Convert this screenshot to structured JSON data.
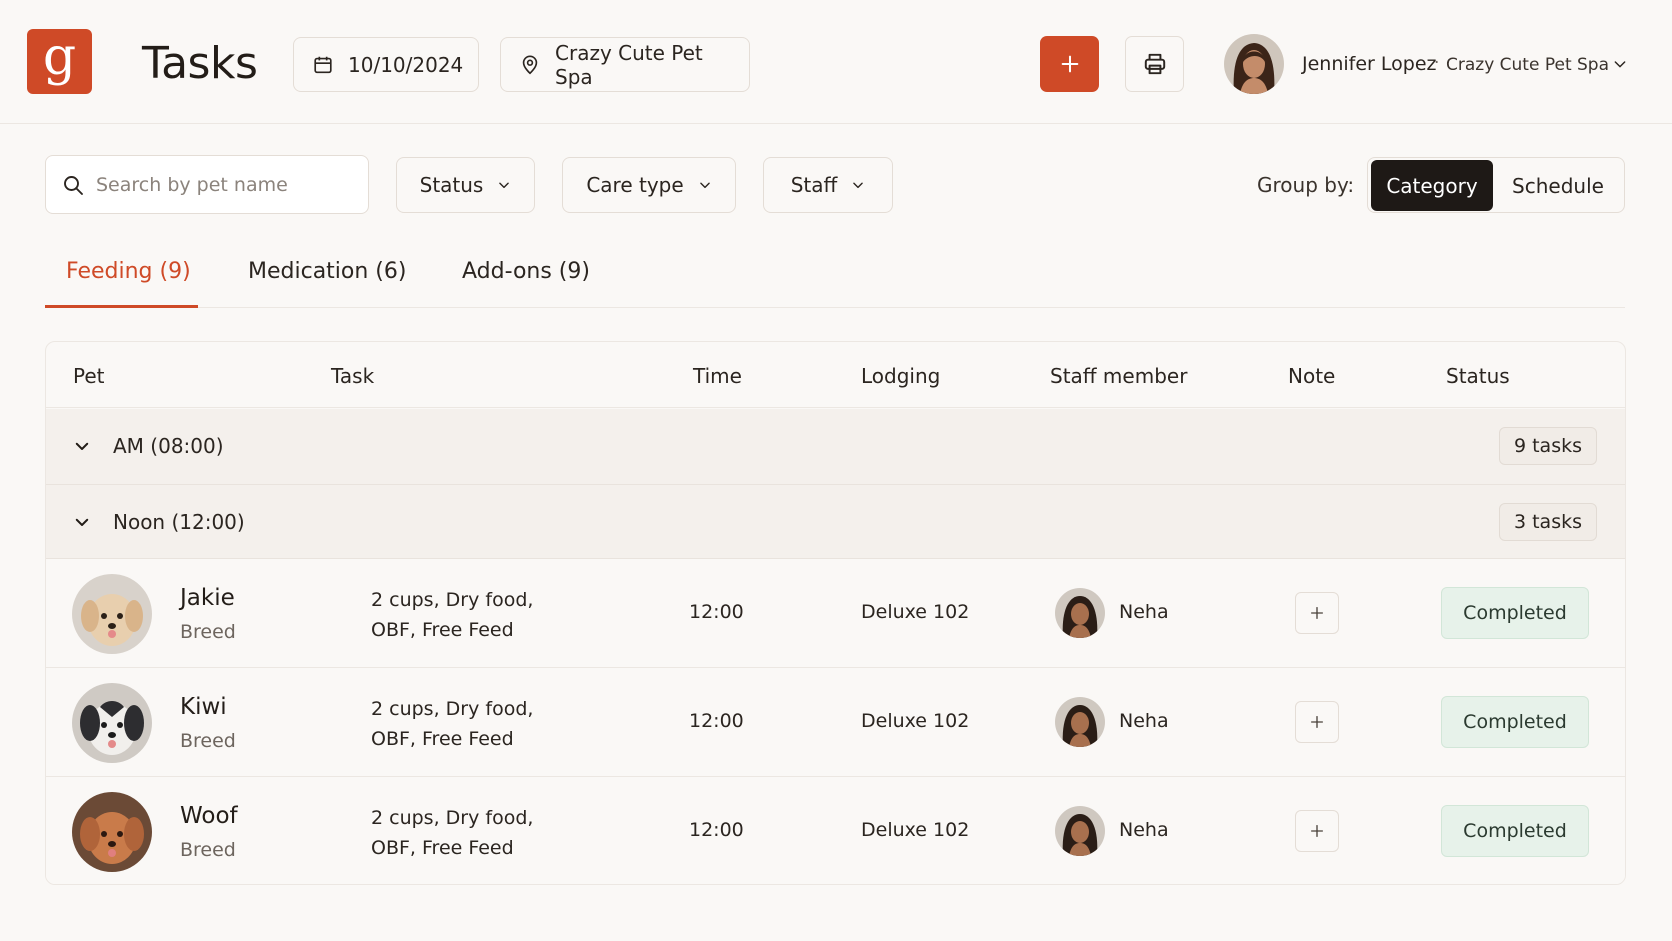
{
  "brand": {
    "logo_letter": "g",
    "accent": "#cf4a27"
  },
  "header": {
    "title": "Tasks",
    "date": "10/10/2024",
    "location": "Crazy Cute Pet Spa",
    "user": {
      "name": "Jennifer Lopez",
      "separator": "·",
      "org": "Crazy Cute Pet Spa"
    }
  },
  "filters": {
    "search_placeholder": "Search by pet name",
    "status": "Status",
    "care_type": "Care type",
    "staff": "Staff",
    "group_by_label": "Group by:",
    "group_options": [
      "Category",
      "Schedule"
    ],
    "group_selected": "Category"
  },
  "tabs": [
    {
      "label": "Feeding (9)",
      "active": true
    },
    {
      "label": "Medication (6)",
      "active": false
    },
    {
      "label": "Add-ons (9)",
      "active": false
    }
  ],
  "table": {
    "columns": [
      "Pet",
      "Task",
      "Time",
      "Lodging",
      "Staff member",
      "Note",
      "Status"
    ],
    "groups": [
      {
        "label": "AM (08:00)",
        "count": "9 tasks"
      },
      {
        "label": "Noon (12:00)",
        "count": "3 tasks"
      }
    ],
    "rows": [
      {
        "pet": "Jakie",
        "breed": "Breed",
        "task_line1": "2 cups, Dry food,",
        "task_line2": "OBF, Free Feed",
        "time": "12:00",
        "lodging": "Deluxe 102",
        "staff": "Neha",
        "status": "Completed"
      },
      {
        "pet": "Kiwi",
        "breed": "Breed",
        "task_line1": "2 cups, Dry food,",
        "task_line2": "OBF, Free Feed",
        "time": "12:00",
        "lodging": "Deluxe 102",
        "staff": "Neha",
        "status": "Completed"
      },
      {
        "pet": "Woof",
        "breed": "Breed",
        "task_line1": "2 cups, Dry food,",
        "task_line2": "OBF, Free Feed",
        "time": "12:00",
        "lodging": "Deluxe 102",
        "staff": "Neha",
        "status": "Completed"
      }
    ]
  },
  "icons": [
    "calendar-icon",
    "location-pin-icon",
    "plus-icon",
    "printer-icon",
    "chevron-down-icon",
    "search-icon"
  ]
}
